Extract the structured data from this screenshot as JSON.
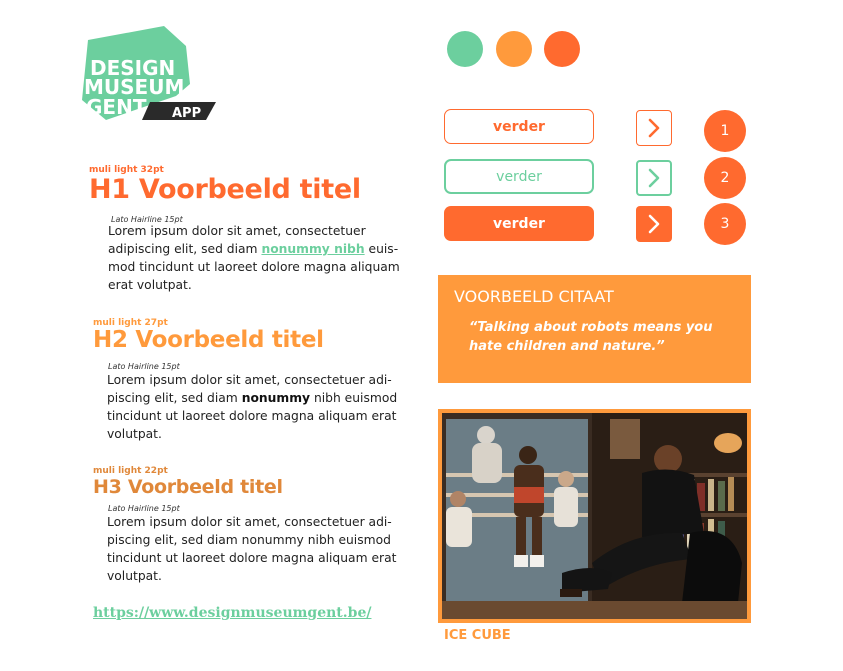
{
  "brand": {
    "logo_lines": [
      "DESIGN",
      "MUSEUM",
      "GENT"
    ],
    "logo_badge": "APP"
  },
  "colors": {
    "green": "#6ccf9e",
    "orange": "#ff9a3c",
    "red_orange": "#ff6a2f"
  },
  "swatches": [
    "green",
    "orange",
    "red_orange"
  ],
  "typography": {
    "h1": {
      "spec": "muli light 32pt",
      "title": "H1 Voorbeeld titel",
      "body_spec": "Lato Hairline 15pt",
      "body_lines": [
        "Lorem ipsum dolor sit amet, consectetuer",
        "adipiscing elit, sed diam ",
        "nonummy nibh",
        " euis-",
        "mod tincidunt ut laoreet dolore magna aliquam",
        "erat volutpat."
      ]
    },
    "h2": {
      "spec": "muli light 27pt",
      "title": "H2 Voorbeeld titel",
      "body_spec": "Lato Hairline 15pt",
      "body_lines": [
        "Lorem ipsum dolor sit amet, consectetuer adi-",
        "piscing elit, sed diam ",
        "nonummy",
        " nibh euismod",
        "tincidunt ut laoreet dolore magna aliquam erat",
        "volutpat."
      ]
    },
    "h3": {
      "spec": "muli light 22pt",
      "title": "H3 Voorbeeld titel",
      "body_spec": "Lato Hairline 15pt",
      "body_lines": [
        "Lorem ipsum dolor sit amet, consectetuer adi-",
        "piscing elit, sed diam nonummy nibh euismod",
        "tincidunt ut laoreet dolore magna aliquam erat",
        "volutpat."
      ]
    }
  },
  "link": "https://www.designmuseumgent.be/",
  "buttons": [
    {
      "label": "verder",
      "style": "outline-orange"
    },
    {
      "label": "verder",
      "style": "outline-green"
    },
    {
      "label": "verder",
      "style": "filled-orange"
    }
  ],
  "arrow_buttons": [
    {
      "icon": "chevron-right-icon",
      "style": "outline-orange"
    },
    {
      "icon": "chevron-right-icon",
      "style": "outline-green"
    },
    {
      "icon": "chevron-right-icon",
      "style": "filled-orange"
    }
  ],
  "steps": [
    "1",
    "2",
    "3"
  ],
  "quote": {
    "title": "VOORBEELD CITAAT",
    "text": "“Talking about robots means you hate children and nature.”"
  },
  "photo": {
    "caption": "ICE CUBE"
  }
}
